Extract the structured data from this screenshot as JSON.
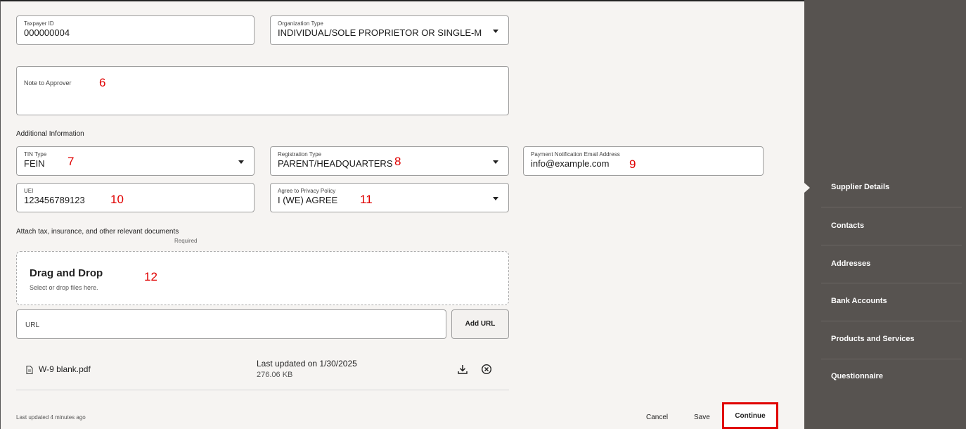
{
  "form": {
    "taxpayer_id": {
      "label": "Taxpayer ID",
      "value": "000000004"
    },
    "organization_type": {
      "label": "Organization Type",
      "value": "INDIVIDUAL/SOLE PROPRIETOR OR SINGLE-MEM"
    },
    "note_to_approver": {
      "label": "Note to Approver",
      "annotation": "6"
    },
    "additional_info_heading": "Additional Information",
    "tin_type": {
      "label": "TIN Type",
      "value": "FEIN",
      "annotation": "7"
    },
    "registration_type": {
      "label": "Registration Type",
      "value": "PARENT/HEADQUARTERS",
      "annotation": "8"
    },
    "payment_email": {
      "label": "Payment Notification Email Address",
      "value": "info@example.com",
      "annotation": "9"
    },
    "uei": {
      "label": "UEI",
      "value": "123456789123",
      "annotation": "10"
    },
    "privacy_policy": {
      "label": "Agree to Privacy Policy",
      "value": "I (WE) AGREE",
      "annotation": "11"
    }
  },
  "attachments": {
    "heading": "Attach tax, insurance, and other relevant documents",
    "required": "Required",
    "dropzone_title": "Drag and Drop",
    "dropzone_sub": "Select or drop files here.",
    "dropzone_annotation": "12",
    "url_placeholder": "URL",
    "add_url_label": "Add URL",
    "file": {
      "name": "W-9 blank.pdf",
      "updated": "Last updated on 1/30/2025",
      "size": "276.06 KB",
      "download_icon": "download-icon",
      "remove_icon": "close-circle-icon"
    }
  },
  "footer": {
    "last_updated": "Last updated 4 minutes ago",
    "cancel": "Cancel",
    "save": "Save",
    "continue": "Continue"
  },
  "sidebar": {
    "items": [
      {
        "label": "Supplier Details",
        "active": true
      },
      {
        "label": "Contacts"
      },
      {
        "label": "Addresses"
      },
      {
        "label": "Bank Accounts"
      },
      {
        "label": "Products and Services"
      },
      {
        "label": "Questionnaire"
      }
    ]
  },
  "colors": {
    "annotation": "#e00000",
    "sidebar_bg": "#575350",
    "page_bg": "#f6f4f2"
  }
}
